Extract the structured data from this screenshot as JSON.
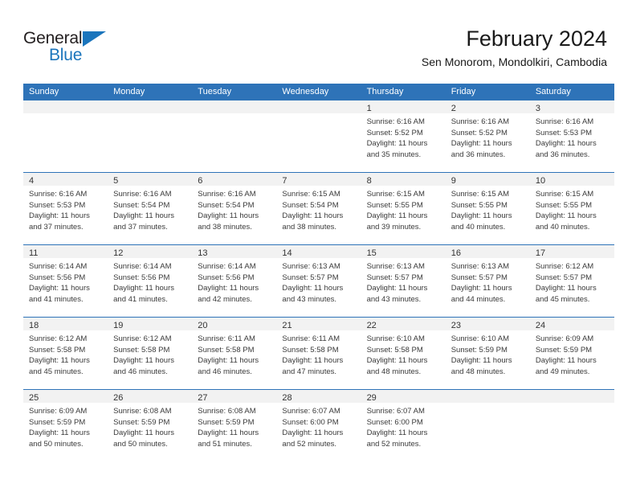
{
  "brand": {
    "name_part1": "General",
    "name_part2": "Blue",
    "accent_color": "#1b75bc"
  },
  "header": {
    "title": "February 2024",
    "subtitle": "Sen Monorom, Mondolkiri, Cambodia"
  },
  "calendar": {
    "header_color": "#2e73b8",
    "daynumber_band_color": "#f2f2f2",
    "weekdays": [
      "Sunday",
      "Monday",
      "Tuesday",
      "Wednesday",
      "Thursday",
      "Friday",
      "Saturday"
    ],
    "weeks": [
      [
        {
          "day": "",
          "lines": []
        },
        {
          "day": "",
          "lines": []
        },
        {
          "day": "",
          "lines": []
        },
        {
          "day": "",
          "lines": []
        },
        {
          "day": "1",
          "lines": [
            "Sunrise: 6:16 AM",
            "Sunset: 5:52 PM",
            "Daylight: 11 hours",
            "and 35 minutes."
          ]
        },
        {
          "day": "2",
          "lines": [
            "Sunrise: 6:16 AM",
            "Sunset: 5:52 PM",
            "Daylight: 11 hours",
            "and 36 minutes."
          ]
        },
        {
          "day": "3",
          "lines": [
            "Sunrise: 6:16 AM",
            "Sunset: 5:53 PM",
            "Daylight: 11 hours",
            "and 36 minutes."
          ]
        }
      ],
      [
        {
          "day": "4",
          "lines": [
            "Sunrise: 6:16 AM",
            "Sunset: 5:53 PM",
            "Daylight: 11 hours",
            "and 37 minutes."
          ]
        },
        {
          "day": "5",
          "lines": [
            "Sunrise: 6:16 AM",
            "Sunset: 5:54 PM",
            "Daylight: 11 hours",
            "and 37 minutes."
          ]
        },
        {
          "day": "6",
          "lines": [
            "Sunrise: 6:16 AM",
            "Sunset: 5:54 PM",
            "Daylight: 11 hours",
            "and 38 minutes."
          ]
        },
        {
          "day": "7",
          "lines": [
            "Sunrise: 6:15 AM",
            "Sunset: 5:54 PM",
            "Daylight: 11 hours",
            "and 38 minutes."
          ]
        },
        {
          "day": "8",
          "lines": [
            "Sunrise: 6:15 AM",
            "Sunset: 5:55 PM",
            "Daylight: 11 hours",
            "and 39 minutes."
          ]
        },
        {
          "day": "9",
          "lines": [
            "Sunrise: 6:15 AM",
            "Sunset: 5:55 PM",
            "Daylight: 11 hours",
            "and 40 minutes."
          ]
        },
        {
          "day": "10",
          "lines": [
            "Sunrise: 6:15 AM",
            "Sunset: 5:55 PM",
            "Daylight: 11 hours",
            "and 40 minutes."
          ]
        }
      ],
      [
        {
          "day": "11",
          "lines": [
            "Sunrise: 6:14 AM",
            "Sunset: 5:56 PM",
            "Daylight: 11 hours",
            "and 41 minutes."
          ]
        },
        {
          "day": "12",
          "lines": [
            "Sunrise: 6:14 AM",
            "Sunset: 5:56 PM",
            "Daylight: 11 hours",
            "and 41 minutes."
          ]
        },
        {
          "day": "13",
          "lines": [
            "Sunrise: 6:14 AM",
            "Sunset: 5:56 PM",
            "Daylight: 11 hours",
            "and 42 minutes."
          ]
        },
        {
          "day": "14",
          "lines": [
            "Sunrise: 6:13 AM",
            "Sunset: 5:57 PM",
            "Daylight: 11 hours",
            "and 43 minutes."
          ]
        },
        {
          "day": "15",
          "lines": [
            "Sunrise: 6:13 AM",
            "Sunset: 5:57 PM",
            "Daylight: 11 hours",
            "and 43 minutes."
          ]
        },
        {
          "day": "16",
          "lines": [
            "Sunrise: 6:13 AM",
            "Sunset: 5:57 PM",
            "Daylight: 11 hours",
            "and 44 minutes."
          ]
        },
        {
          "day": "17",
          "lines": [
            "Sunrise: 6:12 AM",
            "Sunset: 5:57 PM",
            "Daylight: 11 hours",
            "and 45 minutes."
          ]
        }
      ],
      [
        {
          "day": "18",
          "lines": [
            "Sunrise: 6:12 AM",
            "Sunset: 5:58 PM",
            "Daylight: 11 hours",
            "and 45 minutes."
          ]
        },
        {
          "day": "19",
          "lines": [
            "Sunrise: 6:12 AM",
            "Sunset: 5:58 PM",
            "Daylight: 11 hours",
            "and 46 minutes."
          ]
        },
        {
          "day": "20",
          "lines": [
            "Sunrise: 6:11 AM",
            "Sunset: 5:58 PM",
            "Daylight: 11 hours",
            "and 46 minutes."
          ]
        },
        {
          "day": "21",
          "lines": [
            "Sunrise: 6:11 AM",
            "Sunset: 5:58 PM",
            "Daylight: 11 hours",
            "and 47 minutes."
          ]
        },
        {
          "day": "22",
          "lines": [
            "Sunrise: 6:10 AM",
            "Sunset: 5:58 PM",
            "Daylight: 11 hours",
            "and 48 minutes."
          ]
        },
        {
          "day": "23",
          "lines": [
            "Sunrise: 6:10 AM",
            "Sunset: 5:59 PM",
            "Daylight: 11 hours",
            "and 48 minutes."
          ]
        },
        {
          "day": "24",
          "lines": [
            "Sunrise: 6:09 AM",
            "Sunset: 5:59 PM",
            "Daylight: 11 hours",
            "and 49 minutes."
          ]
        }
      ],
      [
        {
          "day": "25",
          "lines": [
            "Sunrise: 6:09 AM",
            "Sunset: 5:59 PM",
            "Daylight: 11 hours",
            "and 50 minutes."
          ]
        },
        {
          "day": "26",
          "lines": [
            "Sunrise: 6:08 AM",
            "Sunset: 5:59 PM",
            "Daylight: 11 hours",
            "and 50 minutes."
          ]
        },
        {
          "day": "27",
          "lines": [
            "Sunrise: 6:08 AM",
            "Sunset: 5:59 PM",
            "Daylight: 11 hours",
            "and 51 minutes."
          ]
        },
        {
          "day": "28",
          "lines": [
            "Sunrise: 6:07 AM",
            "Sunset: 6:00 PM",
            "Daylight: 11 hours",
            "and 52 minutes."
          ]
        },
        {
          "day": "29",
          "lines": [
            "Sunrise: 6:07 AM",
            "Sunset: 6:00 PM",
            "Daylight: 11 hours",
            "and 52 minutes."
          ]
        },
        {
          "day": "",
          "lines": []
        },
        {
          "day": "",
          "lines": []
        }
      ]
    ]
  }
}
